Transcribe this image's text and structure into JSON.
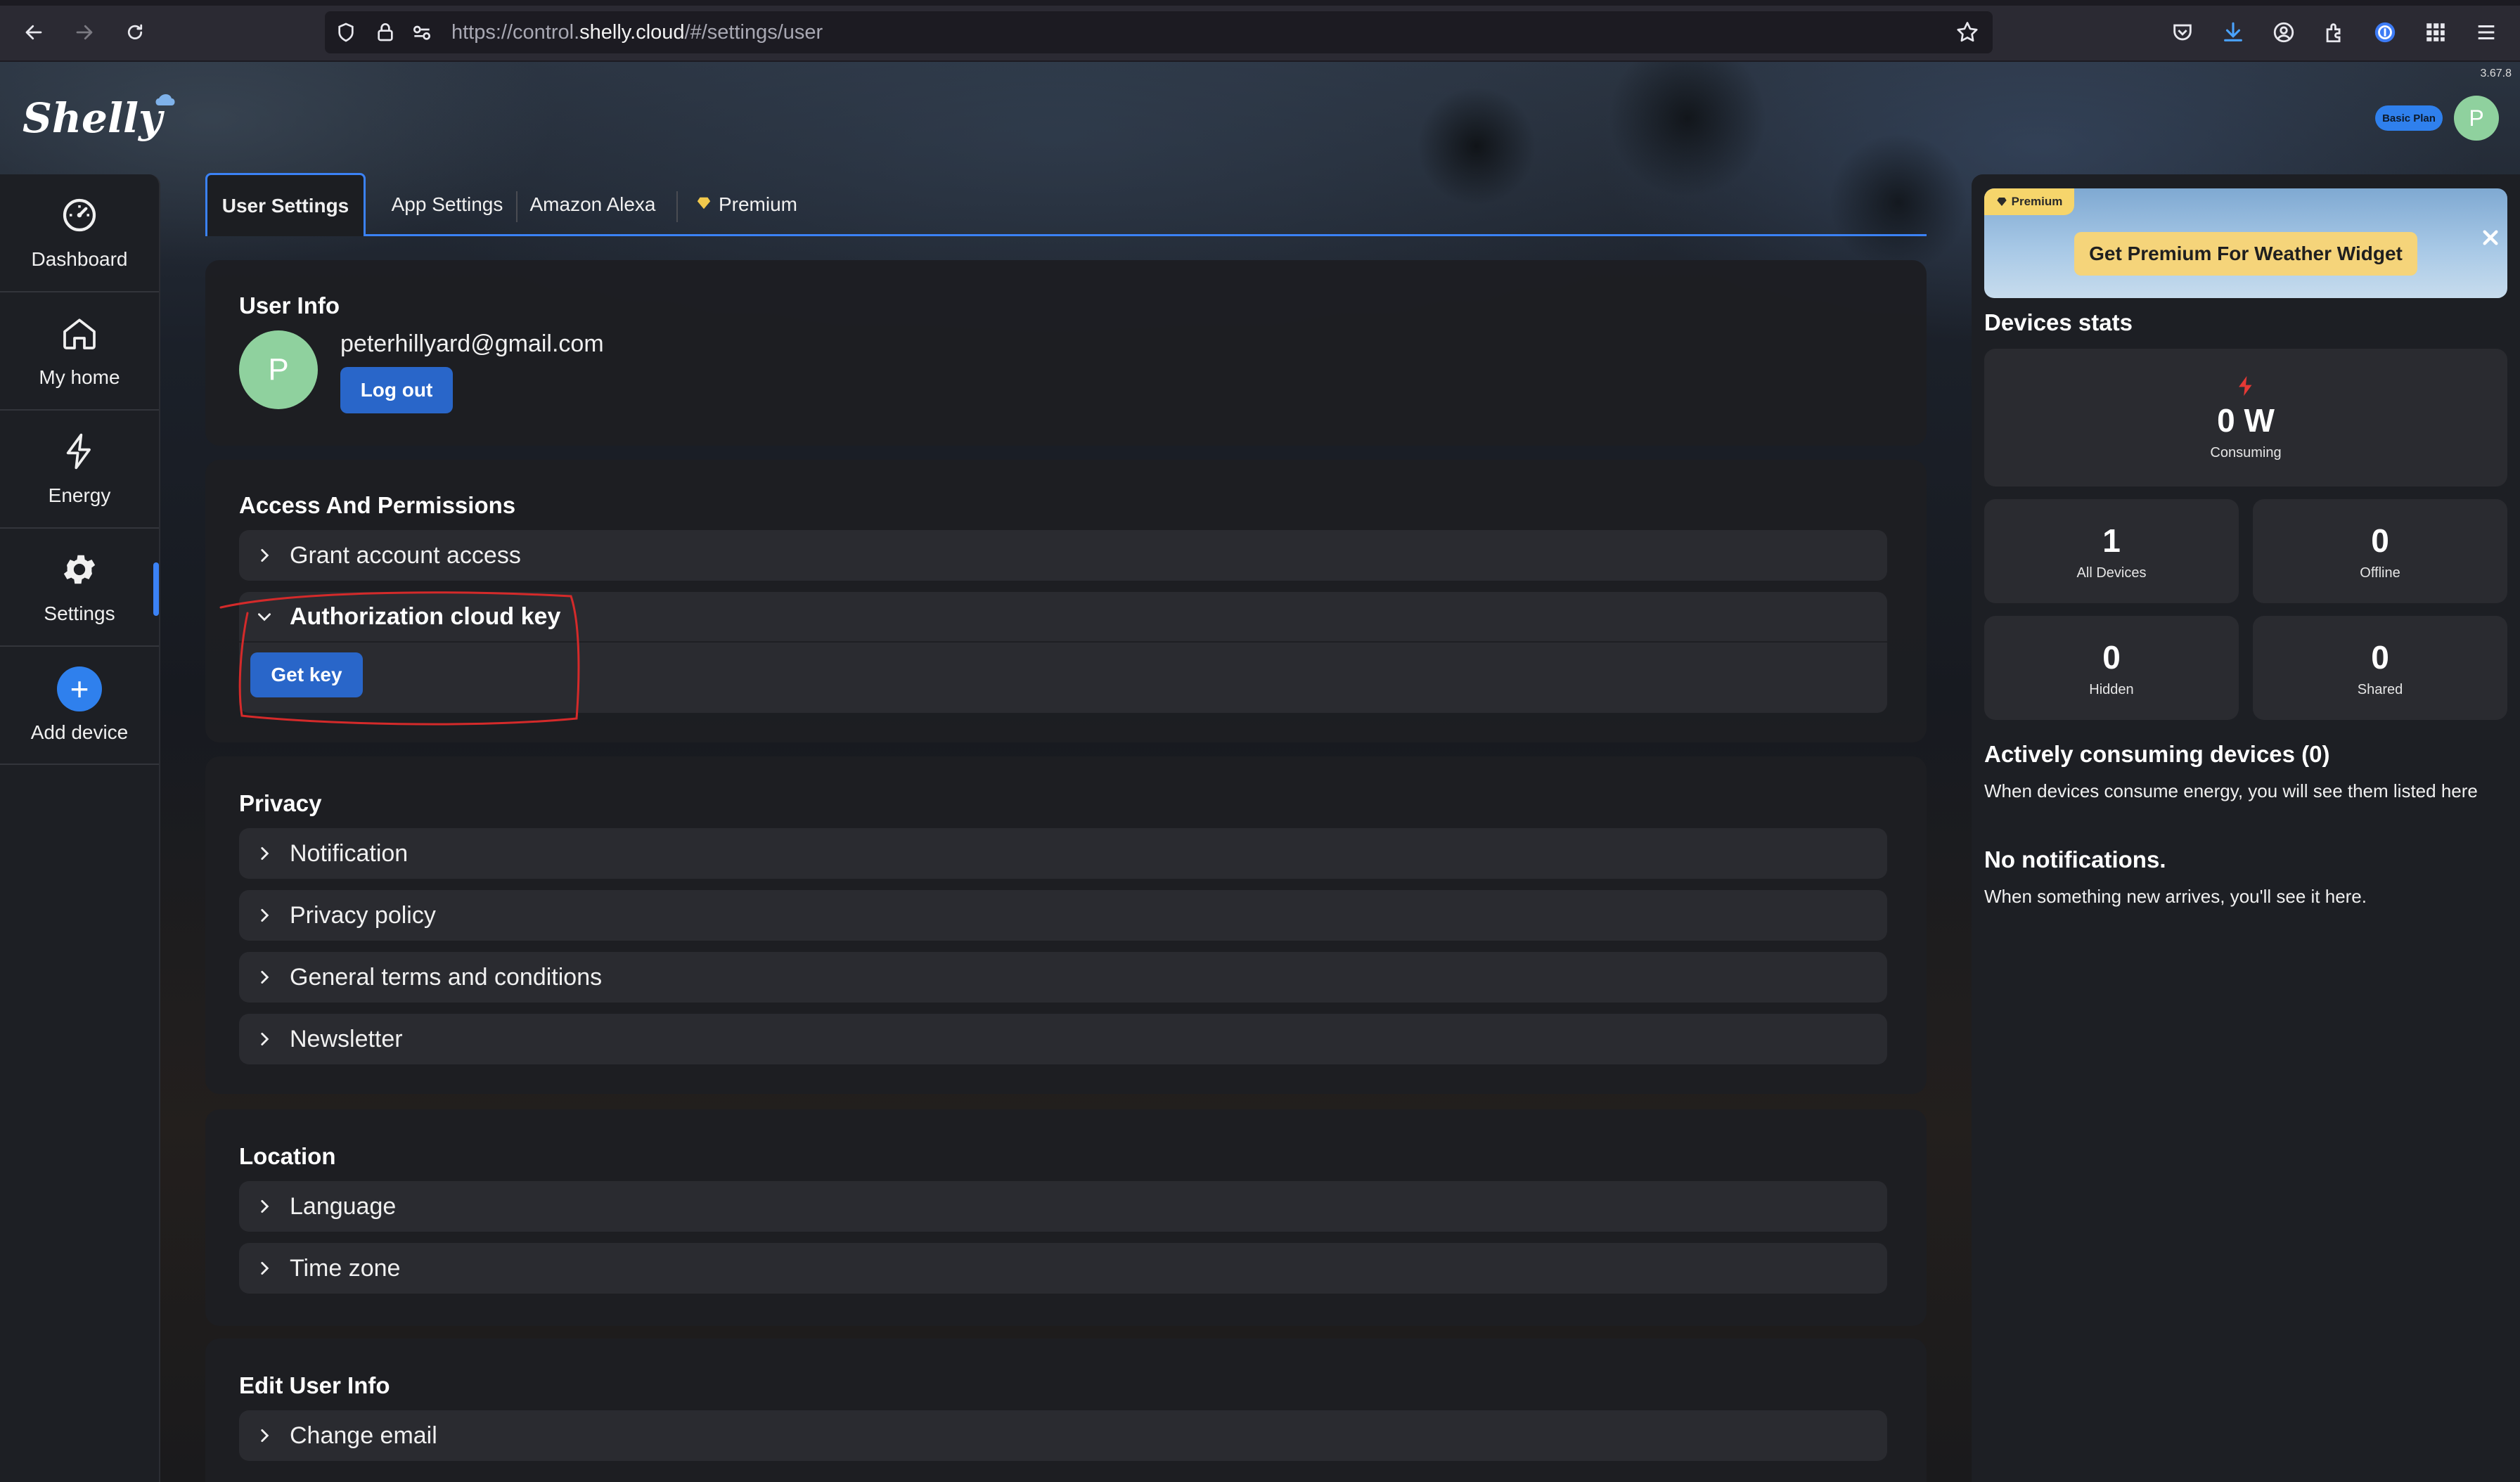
{
  "browser": {
    "url_prefix": "https://control.",
    "url_domain": "shelly.cloud",
    "url_suffix": "/#/settings/user"
  },
  "header": {
    "logo_text": "Shelly",
    "version": "3.67.8",
    "plan_badge": "Basic Plan",
    "avatar_initial": "P"
  },
  "sidebar": {
    "items": [
      {
        "label": "Dashboard",
        "icon": "gauge-icon"
      },
      {
        "label": "My home",
        "icon": "home-icon"
      },
      {
        "label": "Energy",
        "icon": "lightning-icon"
      },
      {
        "label": "Settings",
        "icon": "gear-icon"
      },
      {
        "label": "Add device",
        "icon": "plus-icon"
      }
    ],
    "active": "Settings"
  },
  "tabs": [
    {
      "label": "User Settings",
      "active": true
    },
    {
      "label": "App Settings"
    },
    {
      "label": "Amazon Alexa"
    },
    {
      "label": "Premium",
      "icon": "diamond-icon"
    }
  ],
  "user_info": {
    "title": "User Info",
    "avatar_initial": "P",
    "email": "peterhillyard@gmail.com",
    "logout_label": "Log out"
  },
  "access": {
    "title": "Access And Permissions",
    "grant_label": "Grant account access",
    "auth_key_label": "Authorization cloud key",
    "get_key_label": "Get key"
  },
  "privacy": {
    "title": "Privacy",
    "items": [
      "Notification",
      "Privacy policy",
      "General terms and conditions",
      "Newsletter"
    ]
  },
  "location": {
    "title": "Location",
    "items": [
      "Language",
      "Time zone"
    ]
  },
  "edit_user": {
    "title": "Edit User Info",
    "items": [
      "Change email"
    ]
  },
  "right_panel": {
    "promo_tag": "Premium",
    "promo_button": "Get Premium For Weather Widget",
    "devices_stats_title": "Devices stats",
    "consuming_value": "0 W",
    "consuming_label": "Consuming",
    "stats": [
      {
        "value": "1",
        "label": "All Devices"
      },
      {
        "value": "0",
        "label": "Offline"
      },
      {
        "value": "0",
        "label": "Hidden"
      },
      {
        "value": "0",
        "label": "Shared"
      }
    ],
    "active_title": "Actively consuming devices (0)",
    "active_text": "When devices consume energy, you will see them listed here",
    "notif_title": "No notifications.",
    "notif_text": "When something new arrives, you'll see it here."
  },
  "colors": {
    "accent": "#2f80ed",
    "annotation": "#d42a2a",
    "energy": "#e53935",
    "avatar": "#8fd19e"
  }
}
